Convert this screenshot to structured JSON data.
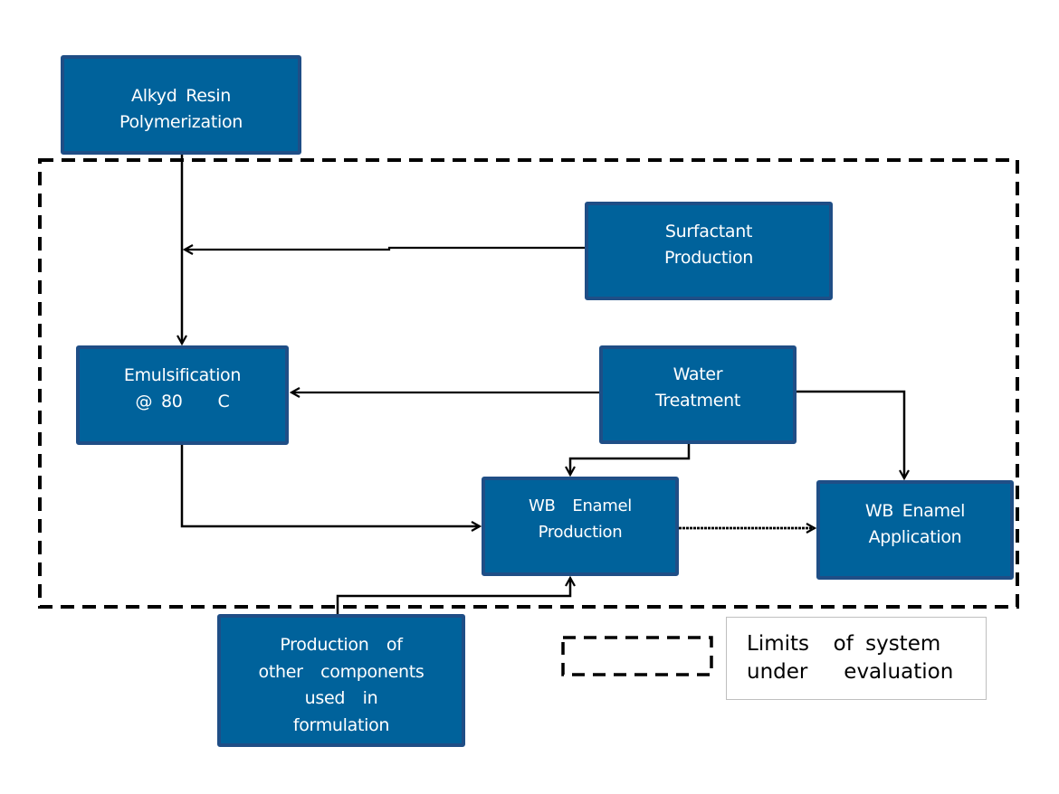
{
  "diagram": {
    "type": "process-flow",
    "colors": {
      "box_fill": "#00629b",
      "box_border": "#1f4e86",
      "box_text": "#ffffff",
      "arrow": "#000000",
      "boundary": "#000000",
      "legend_border": "#bfbfbf"
    },
    "nodes": {
      "alkyd": {
        "label_lines": [
          "Alkyd Resin",
          "Polymerization"
        ]
      },
      "surfactant": {
        "label_lines": [
          "Surfactant",
          "Production"
        ]
      },
      "emulsification": {
        "label_lines": [
          "Emulsification",
          "@ 80    C"
        ]
      },
      "water": {
        "label_lines": [
          "Water",
          "Treatment"
        ]
      },
      "enamel_production": {
        "label_lines": [
          "WB  Enamel",
          "Production"
        ]
      },
      "enamel_application": {
        "label_lines": [
          "WB Enamel",
          "Application"
        ]
      },
      "other_components": {
        "label_lines": [
          "Production  of",
          "other  components",
          "used  in",
          "formulation"
        ]
      }
    },
    "edges": [
      {
        "from": "alkyd",
        "to": "emulsification"
      },
      {
        "from": "surfactant",
        "to": "emulsification"
      },
      {
        "from": "water",
        "to": "emulsification"
      },
      {
        "from": "water",
        "to": "enamel_production"
      },
      {
        "from": "water",
        "to": "enamel_application"
      },
      {
        "from": "emulsification",
        "to": "enamel_production"
      },
      {
        "from": "enamel_production",
        "to": "enamel_application"
      },
      {
        "from": "other_components",
        "to": "enamel_production"
      }
    ],
    "system_boundary": {
      "style": "dashed",
      "contains": [
        "surfactant",
        "emulsification",
        "water",
        "enamel_production",
        "enamel_application"
      ]
    },
    "legend": {
      "symbol": "dashed-rectangle",
      "label_lines": [
        "Limits  of system",
        "under   evaluation"
      ]
    }
  }
}
